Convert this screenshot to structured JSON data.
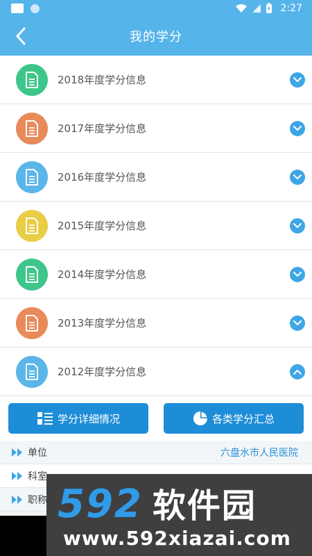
{
  "status_bar": {
    "time": "2:27"
  },
  "header": {
    "title": "我的学分"
  },
  "years": [
    {
      "label": "2018年度学分信息",
      "color": "#3ec68a",
      "expanded": false
    },
    {
      "label": "2017年度学分信息",
      "color": "#e98a5a",
      "expanded": false
    },
    {
      "label": "2016年度学分信息",
      "color": "#5ab5e8",
      "expanded": false
    },
    {
      "label": "2015年度学分信息",
      "color": "#e8cd45",
      "expanded": false
    },
    {
      "label": "2014年度学分信息",
      "color": "#3ec68a",
      "expanded": false
    },
    {
      "label": "2013年度学分信息",
      "color": "#e98a5a",
      "expanded": false
    },
    {
      "label": "2012年度学分信息",
      "color": "#5ab5e8",
      "expanded": true
    }
  ],
  "buttons": {
    "detail": "学分详细情况",
    "summary": "各类学分汇总"
  },
  "info": [
    {
      "key": "单位",
      "value": "六盘水市人民医院"
    },
    {
      "key": "科室",
      "value": ""
    },
    {
      "key": "职称",
      "value": ""
    }
  ],
  "watermark": {
    "logo_num": "592",
    "logo_cn": "软件园",
    "url": "www.592xiazai.com"
  },
  "colors": {
    "primary": "#55b4ea",
    "button": "#1e8dd8",
    "chevron": "#3ea6e6"
  }
}
